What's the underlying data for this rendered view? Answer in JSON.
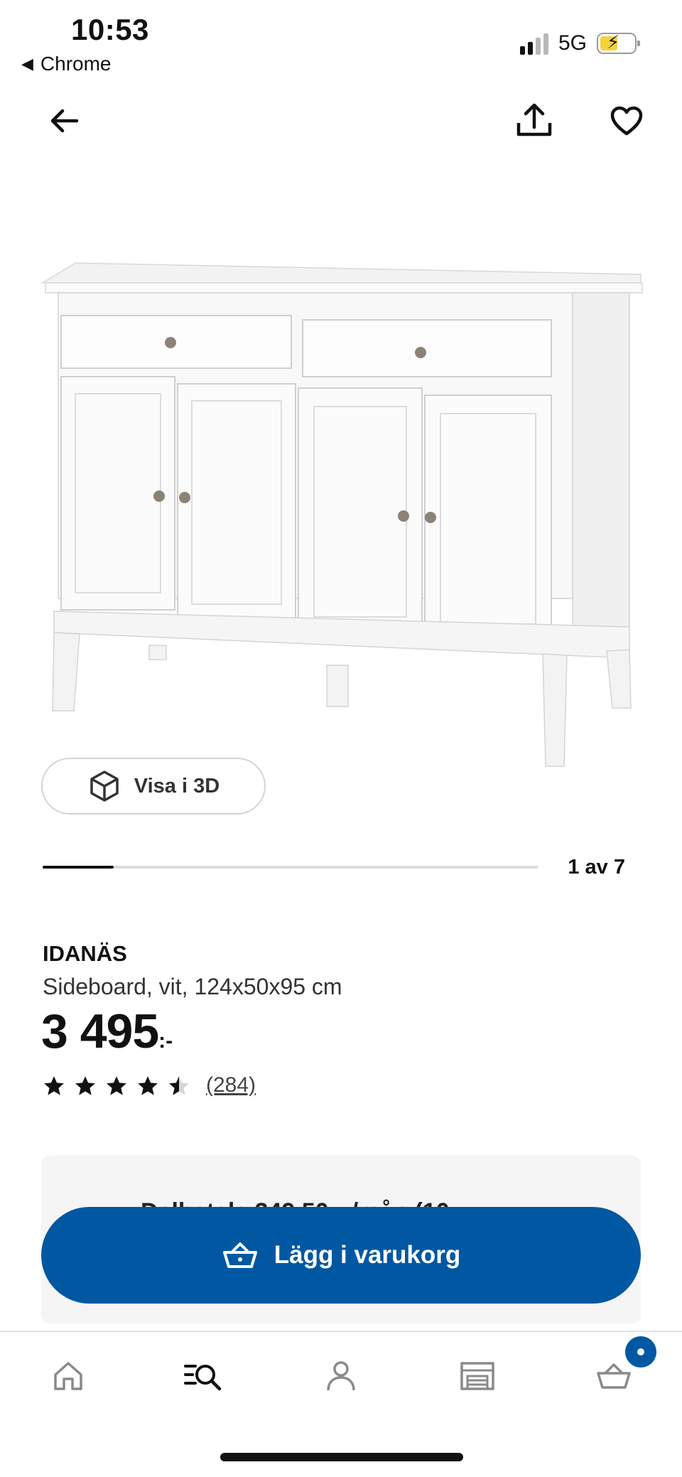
{
  "status_bar": {
    "time": "10:53",
    "back_app": "Chrome",
    "network": "5G"
  },
  "header": {
    "back_icon": "arrow-left-icon",
    "share_icon": "share-icon",
    "favorite_icon": "heart-icon"
  },
  "gallery": {
    "view_3d_label": "Visa i 3D",
    "page_indicator": "1 av 7",
    "progress_fraction": 0.143
  },
  "product": {
    "brand": "IDANÄS",
    "description": "Sideboard, vit, 124x50x95 cm",
    "price_integer": "3 495",
    "price_suffix": ":-",
    "rating_value": 4.5,
    "review_count": "(284)"
  },
  "info_card": {
    "partial_text": "Delbetala 349,50 :-/mån (10"
  },
  "cta": {
    "label": "Lägg i varukorg",
    "icon": "basket-icon",
    "color": "#0058a3"
  },
  "tabbar": {
    "items": [
      "home-icon",
      "search-icon",
      "profile-icon",
      "store-icon",
      "basket-icon"
    ],
    "cart_badge_color": "#0058a3"
  }
}
